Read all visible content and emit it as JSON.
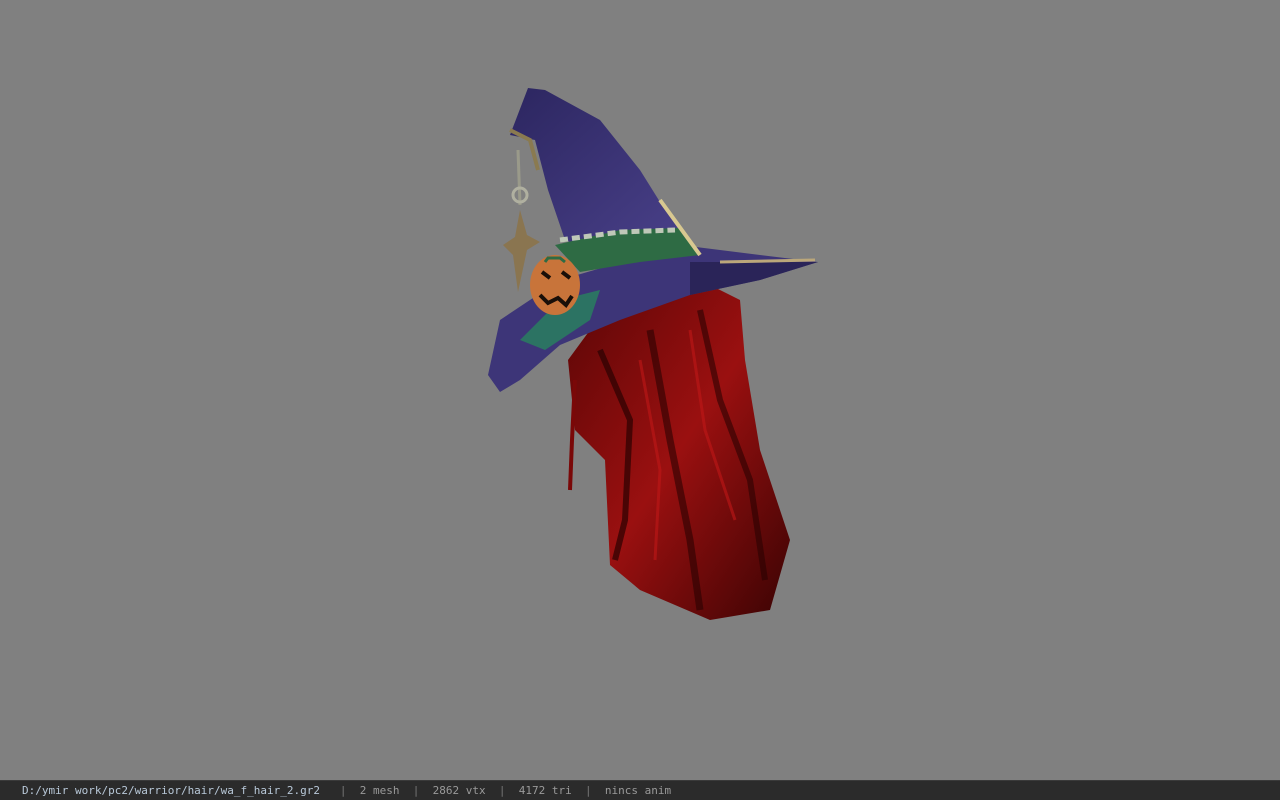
{
  "viewport": {
    "background": "#808080",
    "model": {
      "hat_color": "#3b3373",
      "hair_color": "#8a0c0c",
      "pumpkin_color": "#c8743a",
      "ribbon_color": "#2e6b44"
    }
  },
  "status_bar": {
    "file_path": "D:/ymir work/pc2/warrior/hair/wa_f_hair_2.gr2",
    "separator": "|",
    "mesh_count": "2 mesh",
    "vertex_count": "2862 vtx",
    "triangle_count": "4172 tri",
    "animation": "nincs anim"
  }
}
